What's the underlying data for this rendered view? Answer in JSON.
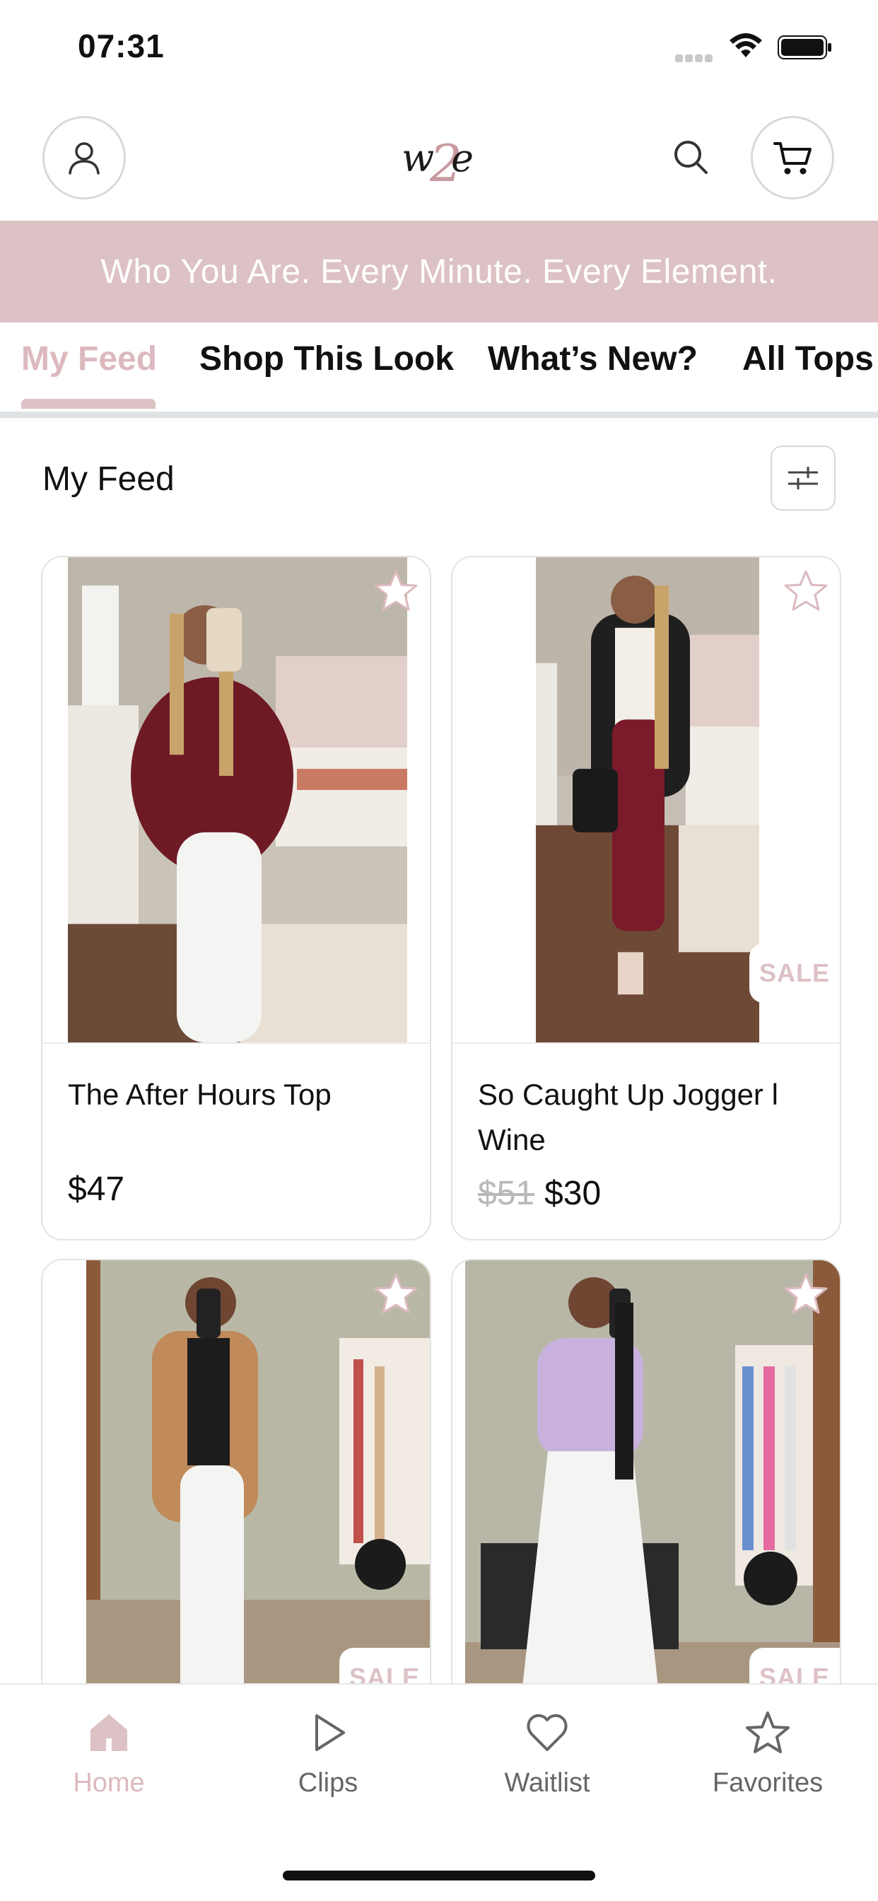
{
  "status_bar": {
    "time": "07:31"
  },
  "header": {
    "logo_text": "w2e"
  },
  "banner": {
    "text": "Who You Are. Every Minute. Every Element."
  },
  "tabs": [
    {
      "label": "My Feed",
      "active": true
    },
    {
      "label": "Shop This Look",
      "active": false
    },
    {
      "label": "What’s New?",
      "active": false
    },
    {
      "label": "All Tops",
      "active": false
    }
  ],
  "section": {
    "title": "My Feed"
  },
  "products": [
    {
      "title": "The After Hours Top",
      "price": "$47",
      "old_price": "",
      "sale": false
    },
    {
      "title": "So Caught Up Jogger l Wine",
      "price": "$30",
      "old_price": "$51",
      "sale": true,
      "sale_label": "SALE"
    },
    {
      "title": "",
      "price": "",
      "old_price": "",
      "sale": true,
      "sale_label": "SALE"
    },
    {
      "title": "",
      "price": "",
      "old_price": "",
      "sale": true,
      "sale_label": "SALE"
    }
  ],
  "bottom_nav": [
    {
      "label": "Home",
      "icon": "home-icon",
      "active": true
    },
    {
      "label": "Clips",
      "icon": "play-icon",
      "active": false
    },
    {
      "label": "Waitlist",
      "icon": "heart-icon",
      "active": false
    },
    {
      "label": "Favorites",
      "icon": "star-icon",
      "active": false
    }
  ],
  "colors": {
    "accent": "#dcc1c5",
    "accent_text": "#dcb9be",
    "divider": "#dfe3e6"
  }
}
